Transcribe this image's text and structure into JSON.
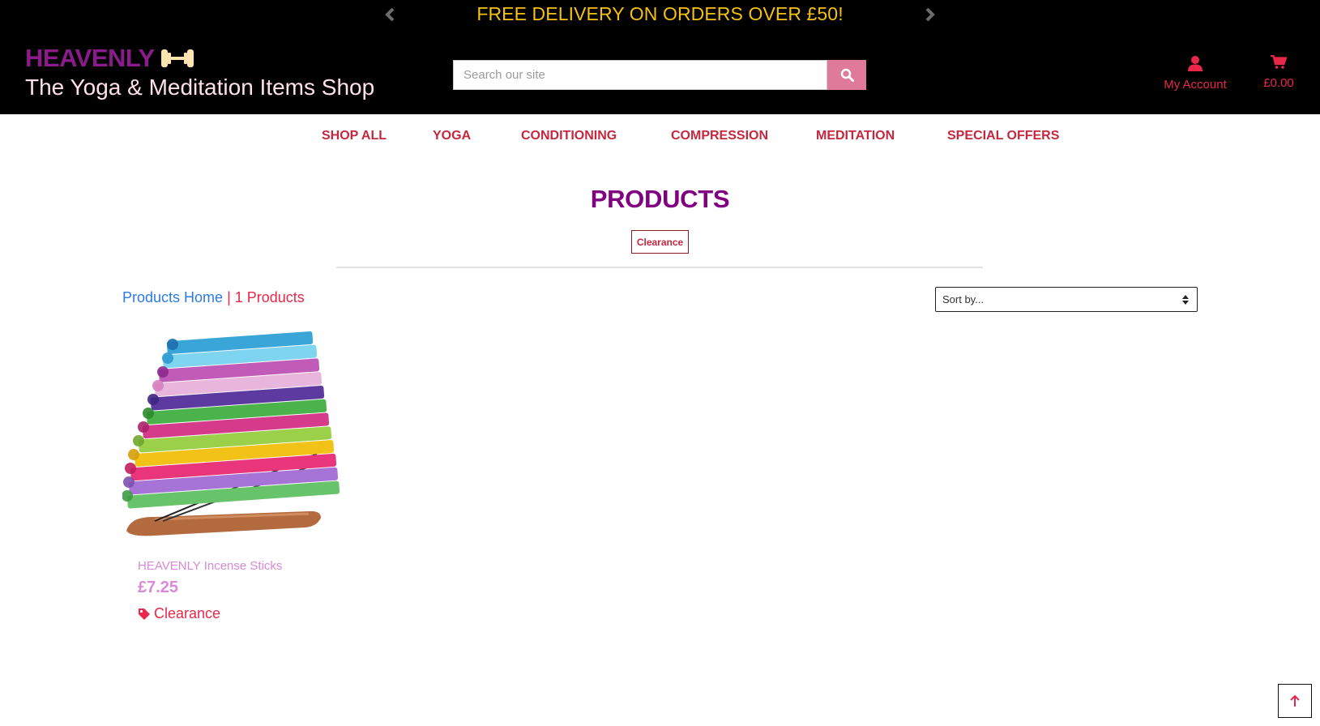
{
  "promo": {
    "text": "FREE DELIVERY ON ORDERS OVER £50!"
  },
  "brand": {
    "name": "HEAVENLY",
    "tagline": "The Yoga & Meditation Items Shop"
  },
  "search": {
    "placeholder": "Search our site"
  },
  "header": {
    "account_label": "My Account",
    "cart_total": "£0.00"
  },
  "nav": {
    "items": [
      {
        "label": "SHOP ALL"
      },
      {
        "label": "YOGA"
      },
      {
        "label": "CONDITIONING"
      },
      {
        "label": "COMPRESSION"
      },
      {
        "label": "MEDITATION"
      },
      {
        "label": "SPECIAL OFFERS"
      }
    ]
  },
  "main": {
    "title": "PRODUCTS",
    "category_badge": "Clearance",
    "breadcrumb_home": "Products Home",
    "breadcrumb_sep": " | ",
    "product_count": "1 Products",
    "sort_placeholder": "Sort by..."
  },
  "products": [
    {
      "name": "HEAVENLY Incense Sticks",
      "price": "£7.25",
      "category": "Clearance"
    }
  ],
  "colors": {
    "brand_purple": "#800080",
    "accent_red": "#e8274a",
    "promo_yellow": "#f5c010",
    "search_button": "#e07a9a"
  }
}
